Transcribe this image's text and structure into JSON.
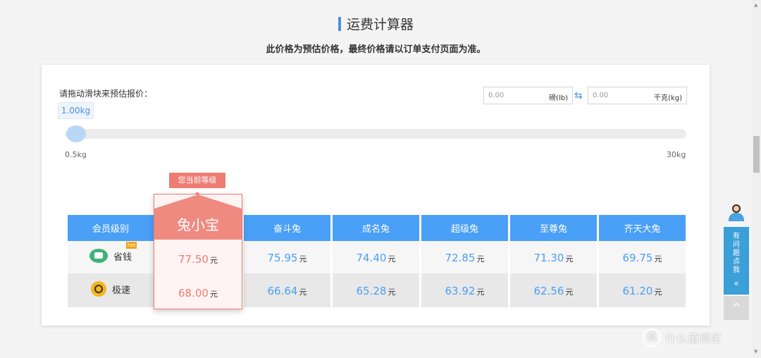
{
  "page": {
    "title": "运费计算器",
    "subtitle": "此价格为预估价格，最终价格请以订单支付页面为准。"
  },
  "slider": {
    "label": "请拖动滑块来预估报价：",
    "current": "1.00kg",
    "min": "0.5kg",
    "max": "30kg",
    "value_kg": 1.0
  },
  "converter": {
    "lb_value": "0.00",
    "lb_unit": "磅(lb)",
    "kg_value": "0.00",
    "kg_unit": "千克(kg)",
    "swap_icon": "swap-arrows"
  },
  "badge": "您当前等级",
  "table": {
    "header_label": "会员级别",
    "levels": [
      {
        "name": "兔小宝",
        "economy": "77.50",
        "express": "68.00",
        "current": true
      },
      {
        "name": "奋斗兔",
        "economy": "75.95",
        "express": "66.64"
      },
      {
        "name": "成名兔",
        "economy": "74.40",
        "express": "65.28"
      },
      {
        "name": "超级兔",
        "economy": "72.85",
        "express": "63.92"
      },
      {
        "name": "至尊兔",
        "economy": "71.30",
        "express": "62.56"
      },
      {
        "name": "齐天大兔",
        "economy": "69.75",
        "express": "61.20"
      }
    ],
    "rows": [
      {
        "label": "省钱",
        "icon": "money-saving-icon",
        "tag": "hot"
      },
      {
        "label": "极速",
        "icon": "stopwatch-icon"
      }
    ],
    "currency": "元"
  },
  "help": {
    "text": "有问题点我",
    "chevron": "«",
    "to_top": "^"
  },
  "watermark": {
    "logo": "值",
    "text": "什么值得买"
  },
  "colors": {
    "accent_blue": "#4a9ff6",
    "highlight_red": "#ed7c72",
    "help_blue": "#3b9fd8"
  }
}
